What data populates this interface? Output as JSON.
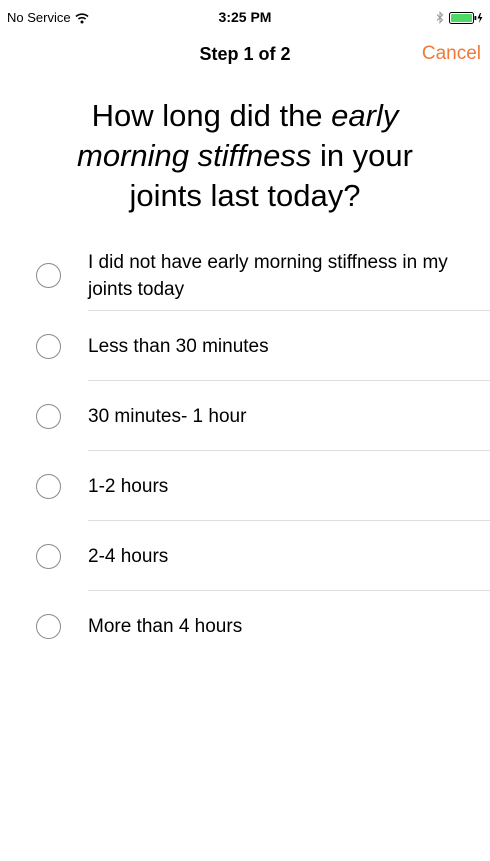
{
  "status_bar": {
    "carrier": "No Service",
    "time": "3:25 PM"
  },
  "nav": {
    "title": "Step 1 of 2",
    "cancel_label": "Cancel",
    "accent_color": "#f0793a"
  },
  "question": {
    "part1": "How long did the ",
    "emphasis": "early morning stiffness",
    "part2": " in your joints last today?"
  },
  "options": [
    {
      "label": "I did not have early morning stiffness in my joints today",
      "selected": false
    },
    {
      "label": "Less than 30 minutes",
      "selected": false
    },
    {
      "label": "30 minutes- 1 hour",
      "selected": false
    },
    {
      "label": "1-2 hours",
      "selected": false
    },
    {
      "label": "2-4 hours",
      "selected": false
    },
    {
      "label": "More than 4 hours",
      "selected": false
    }
  ]
}
